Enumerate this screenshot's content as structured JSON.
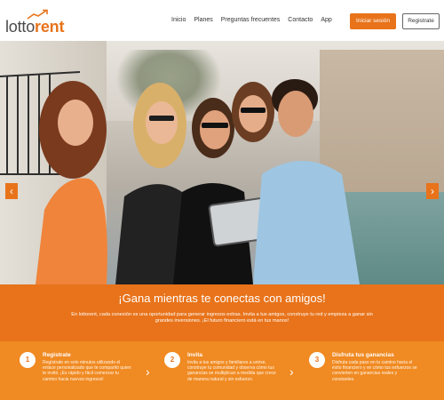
{
  "header": {
    "logo": {
      "part1": "lotto",
      "part2": "rent"
    },
    "nav": [
      "Inicio",
      "Planes",
      "Preguntas frecuentes",
      "Contacto",
      "App"
    ],
    "login_label": "Iniciar sesión",
    "register_label": "Registrate"
  },
  "hero": {
    "prev_icon": "chevron-left-icon",
    "next_icon": "chevron-right-icon",
    "dots_total": 4,
    "active_dot": 1
  },
  "promo": {
    "title": "¡Gana mientras te conectas con amigos!",
    "text": "En lottorent, cada conexión es una oportunidad para generar ingresos extras. Invita a tus amigos, construye tu red y empieza a ganar sin grandes inversiones. ¡El futuro financiero está en tus manos!"
  },
  "steps": [
    {
      "number": "1",
      "title": "Registrate",
      "text": "Regístrate en solo minutos utilizando el enlace personalizado que te compartió quien te invitó. ¡Es rápido y fácil comenzar tu camino hacia nuevos ingresos!"
    },
    {
      "number": "2",
      "title": "Invita",
      "text": "Invita a tus amigos y familiares a unirse, construye tu comunidad y observa cómo tus ganancias se multiplican a medida que crece de manera natural y sin esfuerzo."
    },
    {
      "number": "3",
      "title": "Disfruta tus ganancias",
      "text": "Disfruta cada paso en tu camino hacia el éxito financiero y ve cómo tus esfuerzos se convierten en ganancias reales y constantes."
    }
  ],
  "colors": {
    "accent": "#e8731a",
    "steps_bg": "#f08a22"
  }
}
